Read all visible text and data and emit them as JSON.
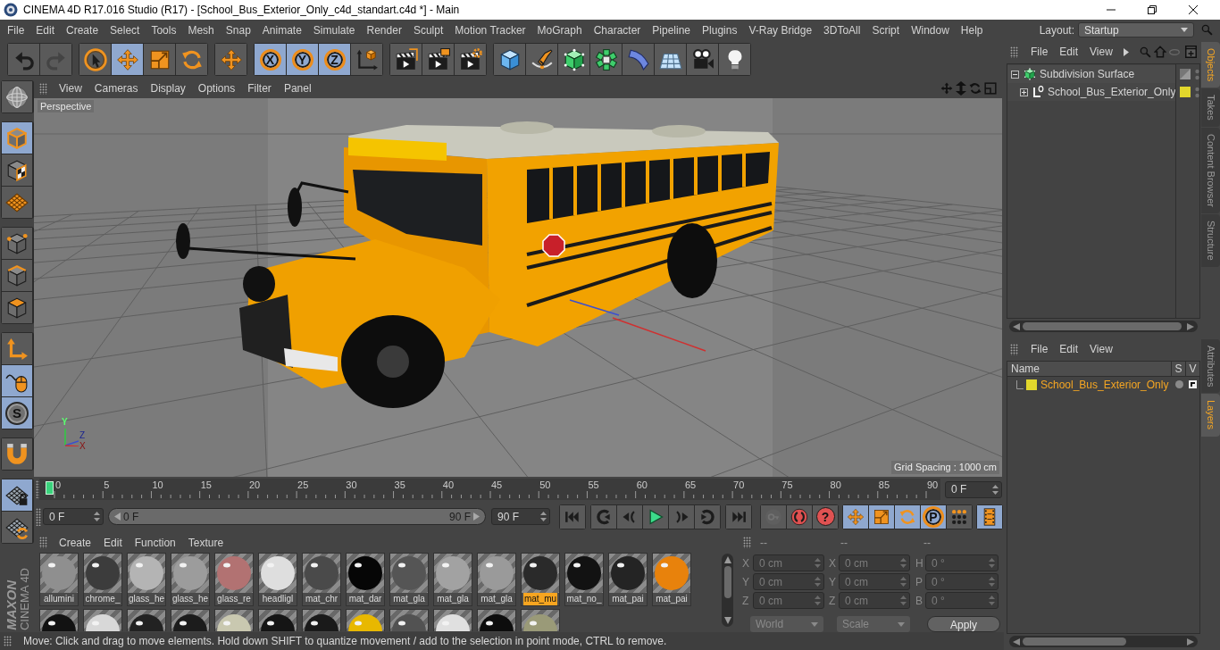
{
  "window": {
    "title": "CINEMA 4D R17.016 Studio (R17) - [School_Bus_Exterior_Only_c4d_standart.c4d *] - Main"
  },
  "menu_bar": [
    "File",
    "Edit",
    "Create",
    "Select",
    "Tools",
    "Mesh",
    "Snap",
    "Animate",
    "Simulate",
    "Render",
    "Sculpt",
    "Motion Tracker",
    "MoGraph",
    "Character",
    "Pipeline",
    "Plugins",
    "V-Ray Bridge",
    "3DToAll",
    "Script",
    "Window",
    "Help"
  ],
  "layout": {
    "label": "Layout:",
    "value": "Startup"
  },
  "toolbar": [
    [
      {
        "kind": "undo",
        "selected": false,
        "disabled": false
      },
      {
        "kind": "redo",
        "selected": false,
        "disabled": true
      }
    ],
    [
      {
        "kind": "selection",
        "selected": false
      },
      {
        "kind": "move",
        "selected": true
      },
      {
        "kind": "scale",
        "selected": false
      },
      {
        "kind": "rotate",
        "selected": false
      }
    ],
    [
      {
        "kind": "move",
        "selected": false
      }
    ],
    [
      {
        "kind": "ring",
        "label": "X",
        "selected": true
      },
      {
        "kind": "ring",
        "label": "Y",
        "selected": true
      },
      {
        "kind": "ring",
        "label": "Z",
        "selected": true
      },
      {
        "kind": "coordsys",
        "selected": false
      }
    ],
    [
      {
        "kind": "renderview",
        "selected": false
      },
      {
        "kind": "renderpicture",
        "selected": false
      },
      {
        "kind": "rendersettings",
        "selected": false
      }
    ],
    [
      {
        "kind": "cube",
        "selected": false
      },
      {
        "kind": "pen",
        "selected": false
      },
      {
        "kind": "subdivision",
        "selected": false
      },
      {
        "kind": "cloner",
        "selected": false
      },
      {
        "kind": "deformer",
        "selected": false
      },
      {
        "kind": "floor",
        "selected": false
      },
      {
        "kind": "camera",
        "selected": false
      },
      {
        "kind": "light",
        "selected": false
      }
    ]
  ],
  "tool_palette": [
    [
      {
        "kind": "makeeditable",
        "selected": false
      }
    ],
    [
      {
        "kind": "model",
        "selected": true
      },
      {
        "kind": "texture",
        "selected": false
      },
      {
        "kind": "workplane",
        "selected": false
      }
    ],
    [
      {
        "kind": "points",
        "selected": false
      },
      {
        "kind": "edges",
        "selected": false
      },
      {
        "kind": "polygons",
        "selected": false
      }
    ],
    [
      {
        "kind": "axis",
        "selected": false
      },
      {
        "kind": "tweak",
        "selected": true
      },
      {
        "kind": "solo",
        "label": "S",
        "selected": true
      }
    ],
    [
      {
        "kind": "snap",
        "selected": false
      }
    ],
    [
      {
        "kind": "lockworkplane",
        "selected": true
      },
      {
        "kind": "planarworkplane",
        "selected": false
      }
    ]
  ],
  "viewport": {
    "menus": [
      "View",
      "Cameras",
      "Display",
      "Options",
      "Filter",
      "Panel"
    ],
    "camera": "Perspective",
    "axis_labels": [
      "Y",
      "Z",
      "X"
    ],
    "grid_spacing": "Grid Spacing : 1000 cm"
  },
  "timeline": {
    "ticks": [
      "0",
      "5",
      "10",
      "15",
      "20",
      "25",
      "30",
      "35",
      "40",
      "45",
      "50",
      "55",
      "60",
      "65",
      "70",
      "75",
      "80",
      "85",
      "90"
    ],
    "level": 0,
    "current_frame": "0 F"
  },
  "transport": {
    "start": "0 F",
    "range": {
      "start": "0 F",
      "end": "90 F"
    },
    "end": "90 F",
    "groups": [
      [
        {
          "kind": "gostart",
          "selected": false
        }
      ],
      [
        {
          "kind": "prevkey",
          "selected": false
        },
        {
          "kind": "prevframe",
          "selected": false
        },
        {
          "kind": "play",
          "selected": false
        },
        {
          "kind": "nextframe",
          "selected": false
        },
        {
          "kind": "nextkey",
          "selected": false
        }
      ],
      [
        {
          "kind": "goend",
          "selected": false
        }
      ],
      [
        {
          "kind": "keyframe",
          "selected": false,
          "disabled": true
        },
        {
          "kind": "autokey",
          "selected": false,
          "disabled": false
        },
        {
          "kind": "alert",
          "label": "?",
          "selected": false,
          "disabled": false
        }
      ],
      [
        {
          "kind": "move",
          "selected": true
        },
        {
          "kind": "scale",
          "selected": true
        },
        {
          "kind": "rotate",
          "selected": true
        },
        {
          "kind": "param",
          "label": "P",
          "selected": true
        },
        {
          "kind": "pla",
          "selected": false
        }
      ],
      [
        {
          "kind": "timeline",
          "selected": true
        }
      ]
    ]
  },
  "materials": {
    "menus": [
      "Create",
      "Edit",
      "Function",
      "Texture"
    ],
    "items": [
      {
        "label": "allumini",
        "color": "#8f8f8f",
        "selected": false
      },
      {
        "label": "chrome_",
        "color": "#3c3c3c",
        "selected": false
      },
      {
        "label": "glass_he",
        "color": "#b4b4b4",
        "selected": false
      },
      {
        "label": "glass_he",
        "color": "#9c9c9c",
        "selected": false
      },
      {
        "label": "glass_re",
        "color": "#b27272",
        "selected": false
      },
      {
        "label": "headligl",
        "color": "#dedede",
        "selected": false
      },
      {
        "label": "mat_chr",
        "color": "#4a4a4a",
        "selected": false
      },
      {
        "label": "mat_dar",
        "color": "#060606",
        "selected": false
      },
      {
        "label": "mat_gla",
        "color": "#555555",
        "selected": false
      },
      {
        "label": "mat_gla",
        "color": "#a2a2a2",
        "selected": false
      },
      {
        "label": "mat_gla",
        "color": "#9a9a9a",
        "selected": false
      },
      {
        "label": "mat_mu",
        "color": "#2a2a2a",
        "selected": true
      },
      {
        "label": "mat_no_",
        "color": "#121212",
        "selected": false
      },
      {
        "label": "mat_pai",
        "color": "#242424",
        "selected": false
      },
      {
        "label": "mat_pai",
        "color": "#e8820c",
        "selected": false
      }
    ],
    "more_items": [
      {
        "color": "#121212",
        "selected": false
      },
      {
        "color": "#d8d8d8",
        "selected": false
      },
      {
        "color": "#222222",
        "selected": false
      },
      {
        "color": "#1c1c1c",
        "selected": false
      },
      {
        "color": "#c9c8b0",
        "selected": false
      },
      {
        "color": "#151515",
        "selected": false
      },
      {
        "color": "#1a1a1a",
        "selected": false
      },
      {
        "color": "#e8b800",
        "selected": false
      },
      {
        "color": "#525252",
        "selected": false
      },
      {
        "color": "#e0e0e0",
        "selected": false
      },
      {
        "color": "#0d0d0d",
        "selected": false
      },
      {
        "color": "#9a9a78",
        "selected": false
      }
    ]
  },
  "coordinates": {
    "disabled": true,
    "headers": [
      "--",
      "--",
      "--"
    ],
    "rows": [
      [
        {
          "label": "X",
          "value": "0 cm"
        },
        {
          "label": "X",
          "value": "0 cm"
        },
        {
          "label": "H",
          "value": "0 °"
        }
      ],
      [
        {
          "label": "Y",
          "value": "0 cm"
        },
        {
          "label": "Y",
          "value": "0 cm"
        },
        {
          "label": "P",
          "value": "0 °"
        }
      ],
      [
        {
          "label": "Z",
          "value": "0 cm"
        },
        {
          "label": "Z",
          "value": "0 cm"
        },
        {
          "label": "B",
          "value": "0 °"
        }
      ]
    ],
    "dropdowns": [
      "World",
      "Scale"
    ],
    "apply": "Apply"
  },
  "object_manager": {
    "menus": [
      "File",
      "Edit",
      "View"
    ],
    "tree": [
      {
        "name": "Subdivision Surface",
        "kind": "subdivision",
        "expanded": true,
        "children": [
          {
            "name": "School_Bus_Exterior_Only",
            "kind": "null",
            "expanded": false,
            "color": "#e2d72c"
          }
        ]
      }
    ]
  },
  "layer_manager": {
    "menus": [
      "File",
      "Edit",
      "View"
    ],
    "columns": [
      "Name",
      "S",
      "V"
    ],
    "layers": [
      {
        "name": "School_Bus_Exterior_Only",
        "color": "#e2d72c",
        "selected": true
      }
    ]
  },
  "side_tabs": {
    "upper": [
      {
        "label": "Objects",
        "selected": true
      },
      {
        "label": "Takes",
        "selected": false
      },
      {
        "label": "Content Browser",
        "selected": false
      },
      {
        "label": "Structure",
        "selected": false
      }
    ],
    "lower": [
      {
        "label": "Attributes",
        "selected": false
      },
      {
        "label": "Layers",
        "selected": true
      }
    ]
  },
  "logo": {
    "brand": "MAXON",
    "product": "CINEMA 4D"
  },
  "status_bar": "Move: Click and drag to move elements. Hold down SHIFT to quantize movement / add to the selection in point mode, CTRL to remove."
}
